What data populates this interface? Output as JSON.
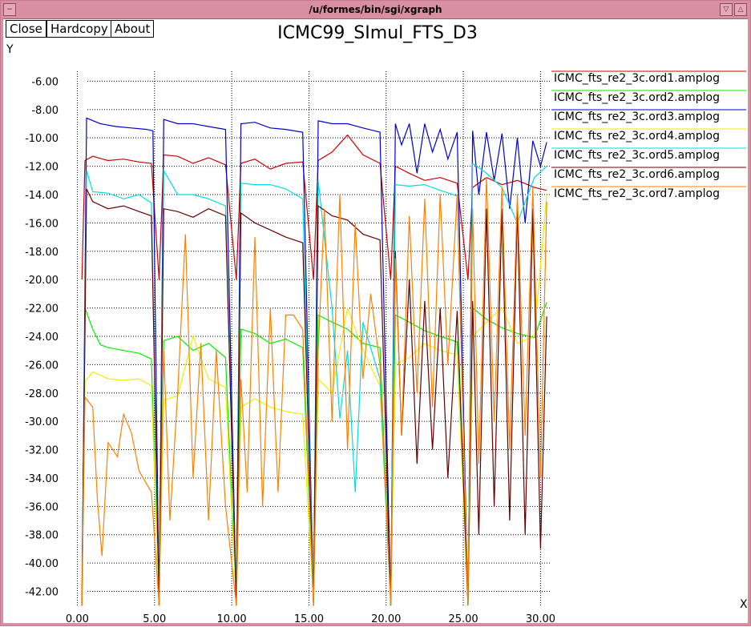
{
  "window": {
    "title": "/u/formes/bin/sgi/xgraph"
  },
  "toolbar": {
    "close_label": "Close",
    "hardcopy_label": "Hardcopy",
    "about_label": "About"
  },
  "chart_data": {
    "type": "line",
    "title": "ICMC99_SImul_FTS_D3",
    "xlabel": "X",
    "ylabel": "Y",
    "xlim": [
      -0.8,
      30.6
    ],
    "ylim": [
      -43.1,
      -5.3
    ],
    "x_ticks": [
      "0.00",
      "5.00",
      "10.00",
      "15.00",
      "20.00",
      "25.00",
      "30.00"
    ],
    "x_tick_values": [
      0,
      5,
      10,
      15,
      20,
      25,
      30
    ],
    "y_ticks": [
      "-6.00",
      "-8.00",
      "-10.00",
      "-12.00",
      "-14.00",
      "-16.00",
      "-18.00",
      "-20.00",
      "-22.00",
      "-24.00",
      "-26.00",
      "-28.00",
      "-30.00",
      "-32.00",
      "-34.00",
      "-36.00",
      "-38.00",
      "-40.00",
      "-42.00"
    ],
    "y_tick_values": [
      -6,
      -8,
      -10,
      -12,
      -14,
      -16,
      -18,
      -20,
      -22,
      -24,
      -26,
      -28,
      -30,
      -32,
      -34,
      -36,
      -38,
      -40,
      -42
    ],
    "grid": true,
    "legend_position": "top-right",
    "series": [
      {
        "name": "ICMC_fts_re2_3c.ord1.amplog",
        "color": "#cc0000",
        "x": [
          0.3,
          0.5,
          1.0,
          2.0,
          3.0,
          4.0,
          4.8,
          5.3,
          5.6,
          6.5,
          7.5,
          8.5,
          9.6,
          10.3,
          10.6,
          11.5,
          12.5,
          13.5,
          14.6,
          15.3,
          15.6,
          16.5,
          17.5,
          18.5,
          19.6,
          20.3,
          20.6,
          21.5,
          22.5,
          23.5,
          24.6,
          25.3,
          25.6,
          26.5,
          27.5,
          28.5,
          29.6,
          30.4
        ],
        "y": [
          -20.0,
          -11.6,
          -11.3,
          -11.6,
          -11.5,
          -11.7,
          -11.8,
          -20.0,
          -11.2,
          -11.3,
          -11.8,
          -11.4,
          -11.9,
          -20.0,
          -11.8,
          -11.5,
          -12.2,
          -11.8,
          -11.7,
          -20.0,
          -11.6,
          -11.0,
          -9.8,
          -11.2,
          -11.8,
          -20.0,
          -12.0,
          -12.5,
          -13.0,
          -12.8,
          -13.2,
          -20.0,
          -13.5,
          -12.8,
          -13.3,
          -13.0,
          -13.5,
          -13.7
        ]
      },
      {
        "name": "ICMC_fts_re2_3c.ord2.amplog",
        "color": "#00ee00",
        "x": [
          0.3,
          0.5,
          1.0,
          1.5,
          2.0,
          3.0,
          4.0,
          4.8,
          5.3,
          5.6,
          6.5,
          7.5,
          8.5,
          9.6,
          10.3,
          10.6,
          11.5,
          12.5,
          13.5,
          14.6,
          15.3,
          15.6,
          16.5,
          17.5,
          18.5,
          19.6,
          20.3,
          20.6,
          21.5,
          22.5,
          23.5,
          24.6,
          25.3,
          25.6,
          26.5,
          27.5,
          28.5,
          29.6,
          30.4
        ],
        "y": [
          -43.0,
          -22.0,
          -23.5,
          -24.6,
          -24.8,
          -25.0,
          -25.2,
          -25.6,
          -43.0,
          -24.3,
          -24.0,
          -25.0,
          -24.5,
          -25.5,
          -43.0,
          -23.5,
          -23.8,
          -24.5,
          -24.2,
          -24.8,
          -43.0,
          -22.5,
          -23.0,
          -23.5,
          -24.5,
          -24.8,
          -43.0,
          -22.5,
          -23.0,
          -23.6,
          -24.0,
          -24.4,
          -43.0,
          -22.0,
          -22.8,
          -23.4,
          -23.8,
          -24.1,
          -21.6
        ]
      },
      {
        "name": "ICMC_fts_re2_3c.ord3.amplog",
        "color": "#0000cc",
        "x": [
          0.3,
          0.6,
          1.5,
          2.5,
          3.5,
          4.5,
          4.9,
          5.3,
          5.6,
          6.5,
          7.5,
          8.5,
          9.6,
          10.3,
          10.6,
          11.5,
          12.5,
          13.5,
          14.6,
          15.3,
          15.6,
          16.5,
          17.5,
          18.5,
          19.6,
          20.3,
          20.6,
          21.0,
          21.5,
          22.0,
          22.5,
          23.0,
          23.5,
          24.0,
          24.6,
          25.3,
          25.6,
          26.0,
          26.5,
          27.0,
          27.5,
          28.0,
          28.5,
          29.0,
          29.5,
          30.0,
          30.4
        ],
        "y": [
          -43.0,
          -8.6,
          -9.0,
          -9.2,
          -9.3,
          -9.4,
          -9.5,
          -43.0,
          -8.7,
          -9.0,
          -9.0,
          -9.2,
          -9.4,
          -43.0,
          -9.0,
          -8.9,
          -9.3,
          -9.4,
          -9.6,
          -43.0,
          -8.8,
          -9.0,
          -9.0,
          -9.3,
          -9.6,
          -43.0,
          -9.0,
          -10.5,
          -9.0,
          -12.5,
          -9.0,
          -11.0,
          -9.4,
          -11.5,
          -9.6,
          -43.0,
          -9.5,
          -14.0,
          -9.6,
          -13.0,
          -9.7,
          -15.0,
          -10.0,
          -16.0,
          -10.2,
          -12.0,
          -10.3
        ]
      },
      {
        "name": "ICMC_fts_re2_3c.ord4.amplog",
        "color": "#eeee00",
        "x": [
          0.3,
          0.5,
          1.0,
          2.0,
          3.0,
          4.0,
          4.8,
          5.3,
          5.6,
          6.5,
          7.5,
          8.5,
          9.6,
          10.3,
          10.6,
          11.5,
          12.5,
          13.5,
          14.6,
          15.3,
          15.6,
          16.5,
          17.5,
          18.5,
          19.6,
          20.3,
          20.6,
          21.5,
          22.5,
          23.5,
          24.6,
          25.3,
          25.6,
          26.5,
          27.5,
          28.5,
          29.6,
          30.4
        ],
        "y": [
          -43.0,
          -27.2,
          -26.5,
          -27.0,
          -27.1,
          -27.0,
          -27.5,
          -43.0,
          -28.5,
          -28.2,
          -24.0,
          -27.0,
          -27.6,
          -43.0,
          -29.0,
          -28.4,
          -29.0,
          -29.3,
          -29.5,
          -43.0,
          -27.0,
          -28.0,
          -22.0,
          -25.0,
          -27.5,
          -43.0,
          -26.0,
          -25.5,
          -24.5,
          -25.0,
          -25.3,
          -43.0,
          -24.0,
          -23.0,
          -22.0,
          -24.5,
          -24.0,
          -14.0
        ]
      },
      {
        "name": "ICMC_fts_re2_3c.ord5.amplog",
        "color": "#00dddd",
        "x": [
          0.3,
          0.6,
          1.0,
          2.0,
          3.0,
          4.0,
          4.8,
          5.3,
          5.6,
          6.5,
          7.5,
          8.5,
          9.6,
          10.3,
          10.6,
          11.5,
          12.5,
          13.5,
          14.6,
          15.3,
          15.6,
          16.5,
          17.0,
          17.5,
          18.0,
          18.5,
          19.6,
          20.3,
          20.6,
          21.5,
          22.5,
          23.5,
          24.6,
          25.3,
          25.6,
          26.5,
          27.5,
          28.5,
          29.6,
          30.4
        ],
        "y": [
          -43.0,
          -12.3,
          -13.8,
          -13.9,
          -14.3,
          -14.0,
          -14.6,
          -43.0,
          -12.3,
          -14.0,
          -14.0,
          -14.3,
          -14.8,
          -43.0,
          -13.2,
          -13.3,
          -13.3,
          -13.6,
          -14.3,
          -43.0,
          -13.0,
          -22.0,
          -29.8,
          -25.0,
          -35.0,
          -23.0,
          -27.0,
          -43.0,
          -13.3,
          -13.4,
          -13.3,
          -13.7,
          -14.1,
          -43.0,
          -11.8,
          -12.5,
          -13.5,
          -16.0,
          -12.8,
          -12.0
        ]
      },
      {
        "name": "ICMC_fts_re2_3c.ord6.amplog",
        "color": "#660000",
        "x": [
          0.3,
          0.6,
          1.0,
          2.0,
          3.0,
          4.0,
          4.8,
          5.3,
          5.6,
          6.5,
          7.5,
          8.5,
          9.6,
          10.3,
          10.6,
          11.5,
          12.5,
          13.5,
          14.6,
          15.3,
          15.6,
          16.5,
          17.5,
          18.5,
          19.6,
          20.3,
          20.6,
          21.0,
          21.5,
          22.0,
          22.5,
          23.0,
          23.5,
          24.0,
          24.6,
          25.3,
          25.6,
          26.0,
          26.5,
          27.0,
          27.5,
          28.0,
          28.5,
          29.0,
          29.5,
          30.0,
          30.4
        ],
        "y": [
          -43.0,
          -13.6,
          -14.5,
          -15.0,
          -14.8,
          -15.2,
          -15.5,
          -43.0,
          -15.0,
          -15.2,
          -15.6,
          -15.0,
          -15.5,
          -43.0,
          -15.3,
          -16.0,
          -16.5,
          -17.0,
          -17.4,
          -43.0,
          -14.8,
          -15.5,
          -15.8,
          -16.8,
          -17.2,
          -43.0,
          -18.0,
          -31.0,
          -20.0,
          -33.0,
          -21.5,
          -32.0,
          -22.0,
          -34.0,
          -22.2,
          -43.0,
          -21.5,
          -38.0,
          -15.0,
          -36.0,
          -15.0,
          -37.0,
          -15.0,
          -38.0,
          -15.0,
          -39.0,
          -22.6
        ]
      },
      {
        "name": "ICMC_fts_re2_3c.ord7.amplog",
        "color": "#ff8000",
        "x": [
          0.3,
          0.5,
          1.0,
          1.3,
          1.6,
          2.0,
          2.6,
          3.0,
          3.5,
          4.0,
          4.8,
          5.3,
          5.6,
          6.0,
          6.5,
          7.0,
          7.5,
          8.0,
          8.5,
          9.0,
          9.6,
          10.3,
          10.6,
          11.0,
          11.5,
          12.0,
          12.5,
          13.0,
          13.5,
          14.0,
          14.6,
          15.3,
          15.6,
          16.0,
          16.5,
          17.0,
          17.5,
          18.0,
          18.5,
          19.0,
          19.6,
          20.3,
          20.6,
          21.0,
          21.5,
          22.0,
          22.5,
          23.0,
          23.5,
          24.0,
          24.6,
          25.3,
          25.6,
          26.0,
          26.5,
          27.0,
          27.5,
          28.0,
          28.5,
          29.0,
          29.5,
          30.0,
          30.4
        ],
        "y": [
          -43.0,
          -28.3,
          -29.0,
          -35.5,
          -39.5,
          -31.5,
          -32.5,
          -29.5,
          -30.8,
          -33.5,
          -35.0,
          -43.0,
          -25.0,
          -37.0,
          -28.0,
          -16.8,
          -34.0,
          -24.5,
          -37.0,
          -25.0,
          -36.0,
          -43.0,
          -27.0,
          -35.0,
          -17.0,
          -36.0,
          -22.0,
          -35.0,
          -22.5,
          -22.5,
          -23.5,
          -43.0,
          -25.0,
          -15.0,
          -30.0,
          -14.0,
          -32.0,
          -16.0,
          -27.0,
          -21.0,
          -26.0,
          -43.0,
          -18.5,
          -31.0,
          -15.5,
          -28.0,
          -14.3,
          -29.0,
          -14.0,
          -26.0,
          -14.0,
          -43.0,
          -15.0,
          -33.0,
          -12.8,
          -30.0,
          -13.5,
          -32.0,
          -14.0,
          -31.0,
          -13.5,
          -34.0,
          -14.5
        ]
      }
    ]
  }
}
